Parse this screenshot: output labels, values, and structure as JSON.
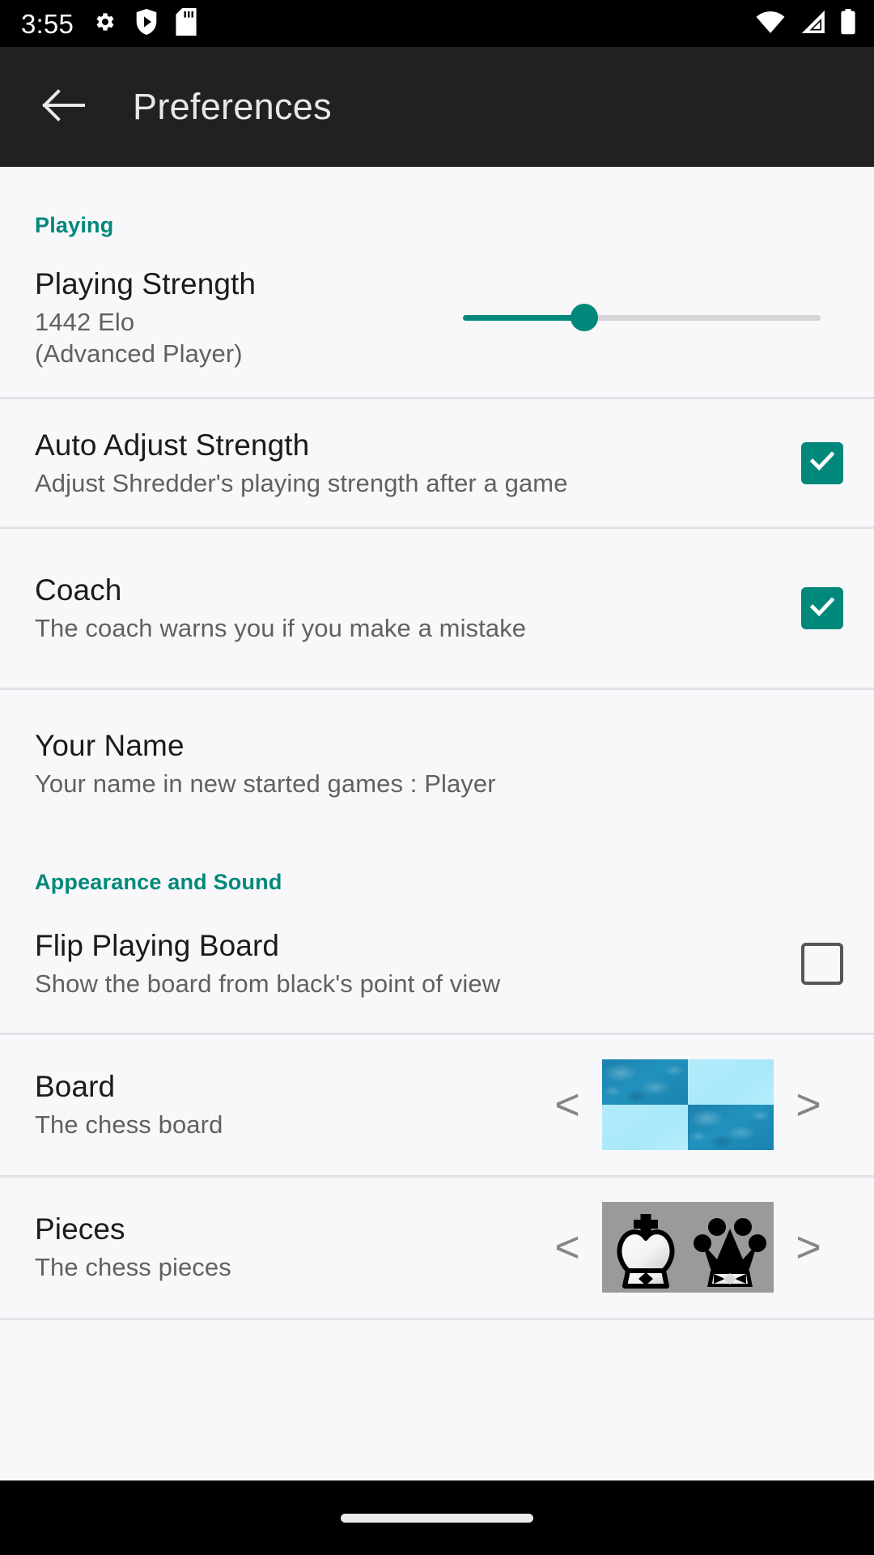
{
  "status_bar": {
    "time": "3:55",
    "left_icons": [
      "gear-icon",
      "shield-play-icon",
      "sd-card-icon"
    ],
    "right_icons": [
      "wifi-icon",
      "cellular-signal-icon",
      "battery-icon"
    ]
  },
  "app_bar": {
    "back_icon": "back-arrow-icon",
    "title": "Preferences"
  },
  "colors": {
    "accent": "#00897b",
    "appbar_bg": "#212124",
    "page_bg": "#f8f8fa",
    "title_text": "#1b1b1b",
    "subtitle_text": "#616161",
    "divider": "#e2e2e6",
    "board_dark_square": "#2191bd",
    "board_light_square": "#a8e8fa",
    "pieces_bg": "#9a9a9a"
  },
  "sections": [
    {
      "header": "Playing",
      "rows": [
        {
          "type": "slider",
          "title": "Playing Strength",
          "subtitle": "1442 Elo\n(Advanced Player)",
          "subtitle_line1": "1442 Elo",
          "subtitle_line2": "(Advanced Player)",
          "elo": 1442,
          "level_label": "Advanced Player",
          "slider_percent": 34
        },
        {
          "type": "checkbox",
          "title": "Auto Adjust Strength",
          "subtitle": "Adjust Shredder's playing strength after a game",
          "checked": true
        },
        {
          "type": "checkbox",
          "title": "Coach",
          "subtitle": "The coach warns you if you make a mistake",
          "checked": true
        },
        {
          "type": "text",
          "title": "Your Name",
          "subtitle": "Your name in new started games : Player",
          "value": "Player"
        }
      ]
    },
    {
      "header": "Appearance and Sound",
      "rows": [
        {
          "type": "checkbox",
          "title": "Flip Playing Board",
          "subtitle": "Show the board from black's point of view",
          "checked": false
        },
        {
          "type": "picker",
          "title": "Board",
          "subtitle": "The chess board",
          "prev_label": "<",
          "next_label": ">",
          "preview": "chess-board-swatch"
        },
        {
          "type": "picker",
          "title": "Pieces",
          "subtitle": "The chess pieces",
          "prev_label": "<",
          "next_label": ">",
          "preview": "chess-pieces-swatch"
        }
      ]
    }
  ]
}
